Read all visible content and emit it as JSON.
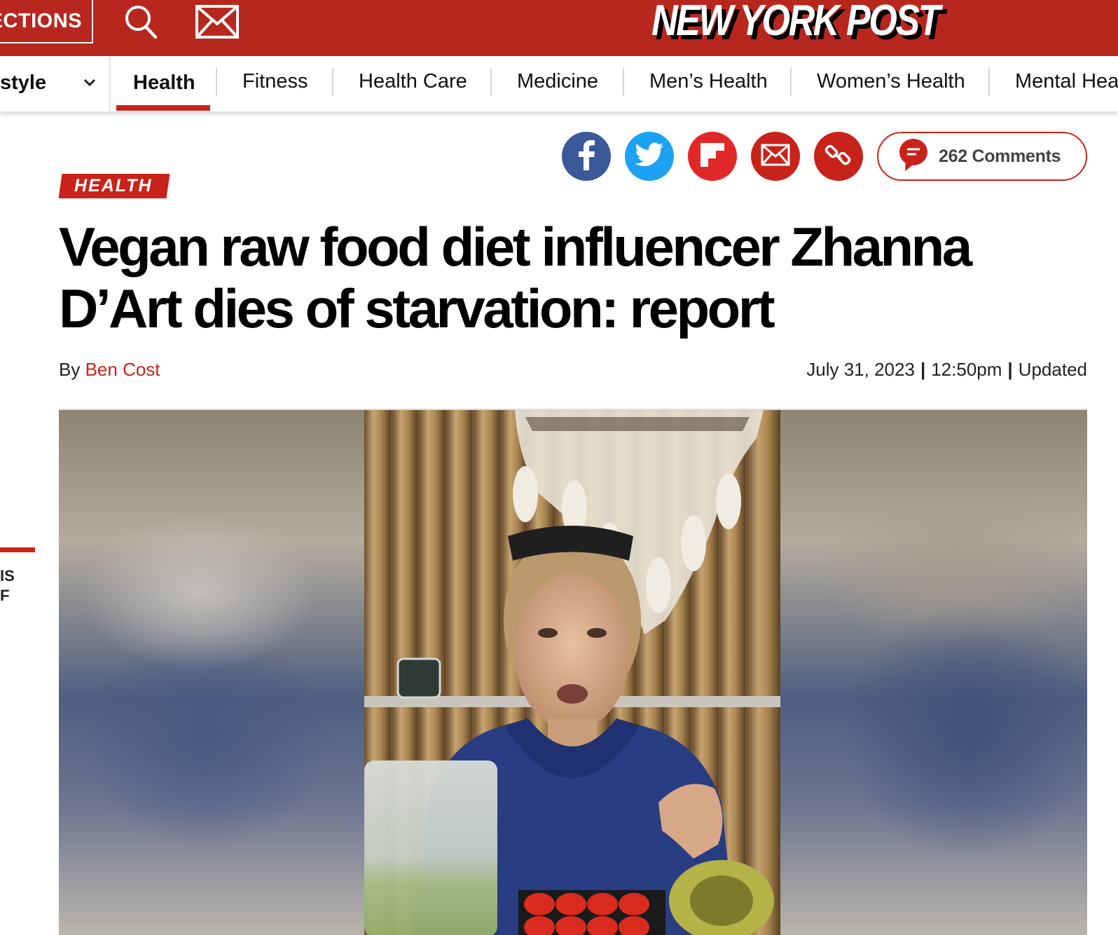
{
  "header": {
    "sections_label": "ECTIONS",
    "logo_text": "NEW YORK POST",
    "colors": {
      "brand_red": "#b8271e",
      "accent_red": "#c8231a"
    }
  },
  "subnav": {
    "parent_label": "style",
    "items": [
      {
        "label": "Health",
        "active": true
      },
      {
        "label": "Fitness"
      },
      {
        "label": "Health Care"
      },
      {
        "label": "Medicine"
      },
      {
        "label": "Men’s Health"
      },
      {
        "label": "Women’s Health"
      },
      {
        "label": "Mental Hea"
      }
    ]
  },
  "share": {
    "icons": [
      "facebook-icon",
      "twitter-icon",
      "flipboard-icon",
      "email-icon",
      "link-icon"
    ],
    "comments_label": "262 Comments"
  },
  "article": {
    "tag": "HEALTH",
    "headline": "Vegan raw food diet influencer Zhanna D’Art dies of starvation: report",
    "byline_prefix": "By",
    "author": "Ben Cost",
    "date": "July 31, 2023",
    "time": "12:50pm",
    "updated": "Updated"
  },
  "sidebar": {
    "line1": "IS",
    "line2": "F"
  }
}
